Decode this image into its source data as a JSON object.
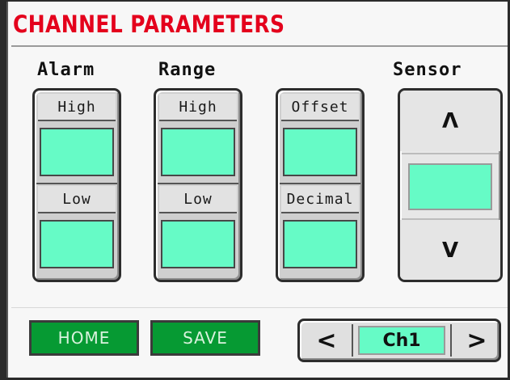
{
  "title": "CHANNEL PARAMETERS",
  "groups": {
    "alarm": "Alarm",
    "range": "Range",
    "sensor": "Sensor"
  },
  "alarm_panel": {
    "high_label": "High",
    "high_value": "",
    "low_label": "Low",
    "low_value": ""
  },
  "range_panel": {
    "high_label": "High",
    "high_value": "",
    "low_label": "Low",
    "low_value": ""
  },
  "offset_panel": {
    "offset_label": "Offset",
    "offset_value": "",
    "decimal_label": "Decimal",
    "decimal_value": ""
  },
  "sensor_panel": {
    "up_label": "Λ",
    "value": "",
    "down_label": "V"
  },
  "buttons": {
    "home": "HOME",
    "save": "SAVE"
  },
  "channel_selector": {
    "prev_label": "<",
    "value": "Ch1",
    "next_label": ">"
  },
  "colors": {
    "title": "#e4001c",
    "field": "#66fbc6",
    "button": "#069a33"
  }
}
